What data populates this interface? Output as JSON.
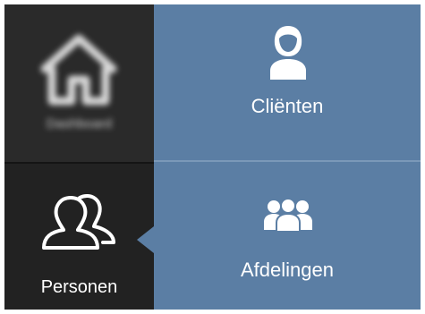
{
  "nav": {
    "items": [
      {
        "label": "Dashboard",
        "icon": "home-icon",
        "blurred": true
      },
      {
        "label": "Personen",
        "icon": "users-outline-icon",
        "active": true
      }
    ]
  },
  "tiles": [
    {
      "label": "Cliënten",
      "icon": "person-icon"
    },
    {
      "label": "Afdelingen",
      "icon": "group-icon"
    }
  ],
  "colors": {
    "sidebar": "#222222",
    "tile": "#5b7ea4",
    "text": "#ffffff"
  }
}
